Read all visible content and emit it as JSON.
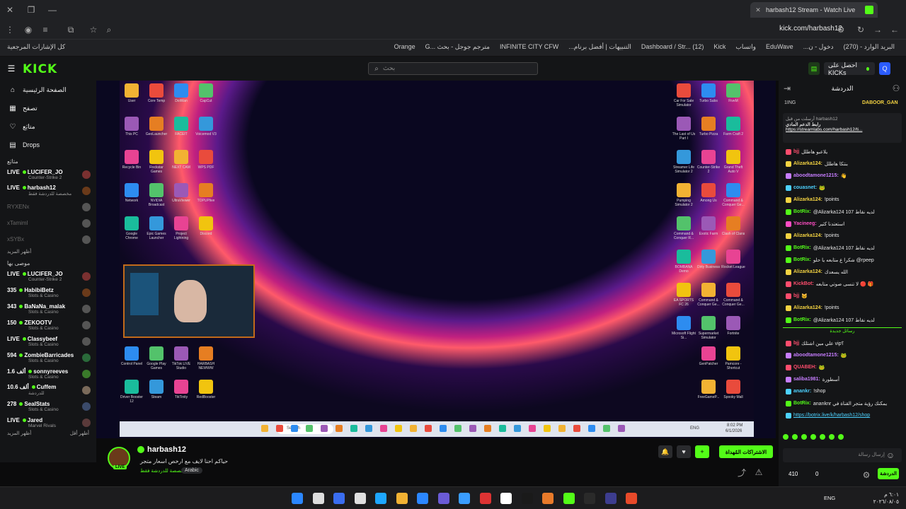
{
  "browser": {
    "tab_title": "harbash12 Stream - Watch Live",
    "url": "kick.com/harbash12",
    "bookmarks_folder": "كل الإشارات المرجعية",
    "bookmarks": [
      "البريد الوارد - (270)",
      "دخول - ن...",
      "EduWave",
      "واتساب",
      "Kick",
      "Dashboard / Str... (12)",
      "التنبيهات | أفضل برنام...",
      "INFINITE CITY CFW",
      "مترجم جوجل - بحث ...G",
      "Orange"
    ]
  },
  "header": {
    "logo": "KICK",
    "search_placeholder": "بحث",
    "kicks_btn": "احصل على KICKs",
    "accent": "#53fc18"
  },
  "sidebar": {
    "nav": [
      {
        "label": "الصفحة الرئيسية",
        "icon": "home-icon"
      },
      {
        "label": "تصفح",
        "icon": "browse-icon"
      },
      {
        "label": "متابَع",
        "icon": "heart-icon"
      },
      {
        "label": "Drops",
        "icon": "drops-icon"
      }
    ],
    "following_title": "متابَع",
    "following": [
      {
        "live": "LIVE",
        "name": "LUCIFER_JO",
        "cat": "Counter-Strike 2",
        "dim": false
      },
      {
        "live": "LIVE",
        "name": "harbash12",
        "cat": "مخصصة للدردشة فقط",
        "dim": false
      },
      {
        "live": "",
        "name": "RYXENx",
        "cat": "",
        "dim": true
      },
      {
        "live": "",
        "name": "xTamimI",
        "cat": "",
        "dim": true
      },
      {
        "live": "",
        "name": "xSYBx",
        "cat": "",
        "dim": true
      }
    ],
    "more1": "أظهر المزيد",
    "recommended_title": "موصى بها",
    "recommended": [
      {
        "live": "LIVE",
        "name": "LUCIFER_JO",
        "cat": "Counter-Strike 2"
      },
      {
        "live": "335",
        "name": "HabibiBetz",
        "cat": "Slots & Casino"
      },
      {
        "live": "343",
        "name": "BaNaNa_malak",
        "cat": "Slots & Casino"
      },
      {
        "live": "150",
        "name": "ZEKOOTV",
        "cat": "Slots & Casino"
      },
      {
        "live": "LIVE",
        "name": "Classybeef",
        "cat": "Slots & Casino"
      },
      {
        "live": "594",
        "name": "ZombieBarricades",
        "cat": "Slots & Casino"
      },
      {
        "live": "1.6 ألف",
        "name": "sonnyreeves",
        "cat": "Slots & Casino"
      },
      {
        "live": "10.6 ألف",
        "name": "Cuffem",
        "cat": "للدردشة"
      },
      {
        "live": "278",
        "name": "SealStats",
        "cat": "Slots & Casino"
      },
      {
        "live": "LIVE",
        "name": "Jared",
        "cat": "Marvel Rivals"
      }
    ],
    "more2": "أظهر المزيد",
    "less": "أظهر أقل"
  },
  "stream": {
    "left_icons": [
      "User",
      "Core Temp",
      "DoiWan",
      "CapCut",
      "This PC",
      "GeoLauncher",
      "FACEIT",
      "Voicemod V3",
      "Recycle Bin",
      "Rockstar Games",
      "NEXT CAM",
      "WPS PDF",
      "Network",
      "NVIDIA Broadcast",
      "UltraViewer",
      "TOPUPlive",
      "Google Chrome",
      "Epic Games Launcher",
      "Project Lightning",
      "Discord"
    ],
    "right_icons": [
      "Car For Sale Simulator",
      "Turbo Subs",
      "FiveM",
      "The Last of Us Part I",
      "Turbo Pizza",
      "Farm Craft 2",
      "Streamer Life Simulator 2",
      "Counter-Strike 2",
      "Grand Theft Auto V",
      "Pumping Simulator 2",
      "Among Us",
      "Command & Conquer Ge...",
      "Command & Conquer R...",
      "Exotic Farm",
      "Clash of Clans",
      "BOMBANA Demo",
      "Dirty Business",
      "Rocket League",
      "EA SPORTS FC 26",
      "Command & Conquer Ge...",
      "Command & Conquer Ge...",
      "Microsoft Flight Si...",
      "Supermarket Simulator",
      "Fortnite"
    ],
    "bottom_icons": [
      "Control Panel",
      "Google Play Games",
      "TikTok LIVE Studio",
      "HARBASH NEWWW",
      "Driver Booster 12",
      "Steam",
      "TikTinity",
      "RedBooster"
    ],
    "bottom_right_icons": [
      "GenPatcher",
      "Pamcore - Shortcut",
      "FreeGameP...",
      "Spooky Mall"
    ],
    "inner_search": "Search",
    "inner_lang": "ENG",
    "inner_time": "8:02 PM",
    "inner_date": "6/1/2026"
  },
  "channel": {
    "name": "harbash12",
    "live": "LIVE",
    "title": "حياكم احنا لايف مع ارخص اسعار متجر",
    "category": "مخصصة للدردشة فقط",
    "language": "Arabic",
    "subscribe": "الاشتراكات المُهداة"
  },
  "chat": {
    "title": "الدردشة",
    "top_left": "1ING",
    "top_right": "DABOOR_GAN",
    "pinned_by": "أرسلت من قبل harbash12",
    "pinned_title": "رابط الدعم المادي",
    "pinned_link": "https://streamlabs.com/harbash12/ti...",
    "messages": [
      {
        "u": "bjj",
        "t": "يلاعبو هاطلل",
        "c": "#ff4d6d"
      },
      {
        "u": "Alizarka124:",
        "t": "بنتكا هاطلل",
        "c": "#f5d442"
      },
      {
        "u": "aboodtamone1215:",
        "t": "👋",
        "c": "#c77dff"
      },
      {
        "u": "couasnet:",
        "t": "🐸",
        "c": "#4dd2ff"
      },
      {
        "u": "Alizarka124:",
        "t": "!points",
        "c": "#f5d442"
      },
      {
        "u": "BotRix:",
        "t": "@Alizarka124 107 لديه نقاط",
        "c": "#53fc18"
      },
      {
        "u": "Yacineeg:",
        "t": "استعتدنا كثير",
        "c": "#ff4dc4"
      },
      {
        "u": "Alizarka124:",
        "t": "!points",
        "c": "#f5d442"
      },
      {
        "u": "BotRix:",
        "t": "@Alizarka124 107 لديه نقاط",
        "c": "#53fc18"
      },
      {
        "u": "BotRix:",
        "t": "شكرا ع متابعه يا حلو @rpeep",
        "c": "#53fc18"
      },
      {
        "u": "Alizarka124:",
        "t": "الله يسعدك",
        "c": "#f5d442"
      },
      {
        "u": "KickBot:",
        "t": "لا تنسى صوتي متابعه 🔴 🎁",
        "c": "#ff4d6d"
      },
      {
        "u": "bjj",
        "t": "🐱",
        "c": "#ff4d6d"
      },
      {
        "u": "Alizarka124:",
        "t": "!points",
        "c": "#f5d442"
      },
      {
        "u": "BotRix:",
        "t": "@Alizarka124 107 لديه نقاط",
        "c": "#53fc18"
      },
      {
        "u": "bjj",
        "t": "علي مين اشتلك vip؟",
        "c": "#ff4d6d"
      },
      {
        "u": "aboodtamone1215:",
        "t": "🐸",
        "c": "#c77dff"
      },
      {
        "u": "QUABEH:",
        "t": "🐸",
        "c": "#ff4d6d"
      },
      {
        "u": "saliba1981:",
        "t": "أسطورة",
        "c": "#c77dff"
      },
      {
        "u": "anankr:",
        "t": "!shop",
        "c": "#4dd2ff"
      },
      {
        "u": "BotRix:",
        "t": "ananknr يمكنك رؤية متجر القناة في",
        "c": "#53fc18"
      },
      {
        "u": "",
        "t": "https://botrix.live/k/harbash12/shop",
        "c": "#4dd2ff"
      }
    ],
    "new_messages": "رسائل جديدة",
    "input_placeholder": "إرسال رسالة",
    "points": "410",
    "zero": "0",
    "send_btn": "الدردشة"
  },
  "os": {
    "lang": "ENG",
    "time": "٦:٠١ م",
    "date": "٢٠٢٦/٠٨/٠٥"
  }
}
